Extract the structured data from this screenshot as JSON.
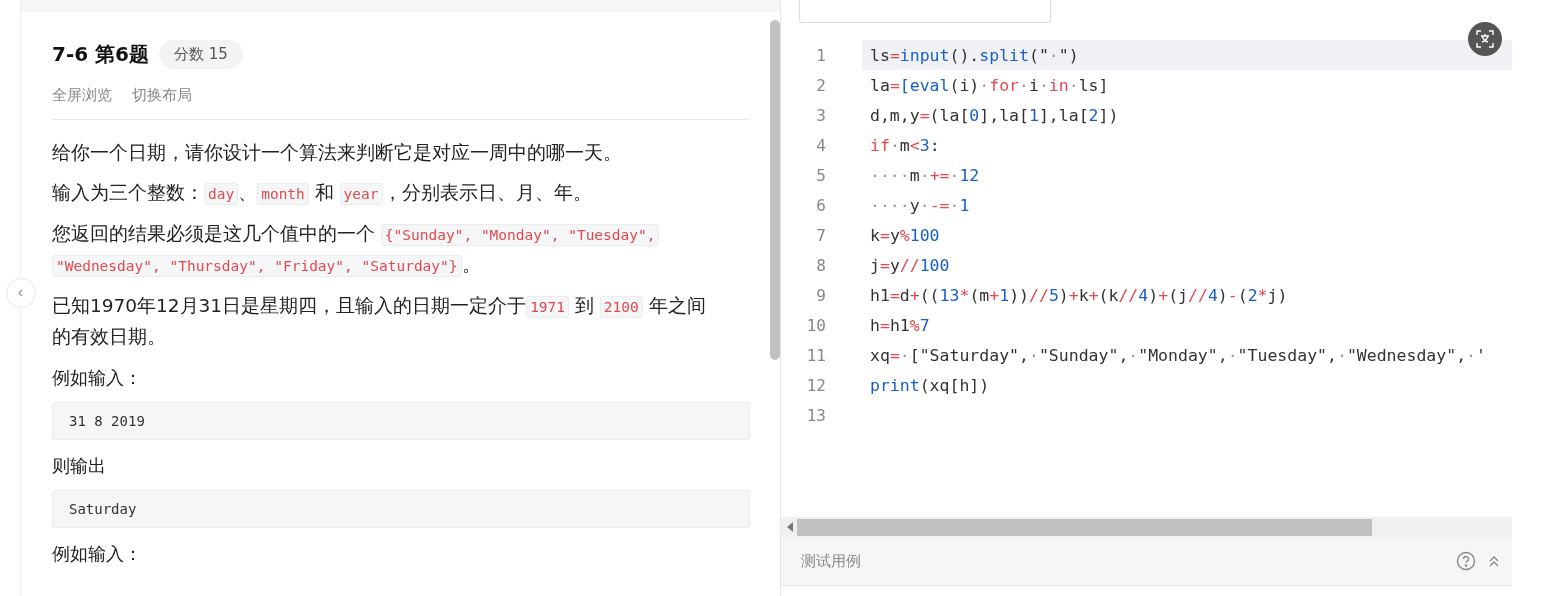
{
  "problem": {
    "title": "7-6 第6题",
    "score_badge": "分数 15",
    "actions": [
      "全屏浏览",
      "切换布局"
    ],
    "paragraphs": [
      [
        {
          "kind": "text",
          "t": "给你一个日期，请你设计一个算法来判断它是对应一周中的哪一天。"
        }
      ],
      [
        {
          "kind": "text",
          "t": "输入为三个整数："
        },
        {
          "kind": "code",
          "t": "day"
        },
        {
          "kind": "text",
          "t": "、"
        },
        {
          "kind": "code",
          "t": "month"
        },
        {
          "kind": "text",
          "t": " 和 "
        },
        {
          "kind": "code",
          "t": "year"
        },
        {
          "kind": "text",
          "t": "，分别表示日、月、年。"
        }
      ],
      [
        {
          "kind": "text",
          "t": "您返回的结果必须是这几个值中的一个 "
        },
        {
          "kind": "code",
          "t": "{\"Sunday\", \"Monday\", \"Tuesday\","
        },
        {
          "kind": "code",
          "t": "\"Wednesday\", \"Thursday\", \"Friday\", \"Saturday\"}"
        },
        {
          "kind": "text",
          "t": "。"
        }
      ],
      [
        {
          "kind": "text",
          "t": "已知1970年12月31日是星期四，且输入的日期一定介于"
        },
        {
          "kind": "code",
          "t": "1971"
        },
        {
          "kind": "text",
          "t": " 到 "
        },
        {
          "kind": "code",
          "t": "2100"
        },
        {
          "kind": "text",
          "t": " 年之间"
        },
        {
          "kind": "text",
          "t": "的有效日期。"
        }
      ]
    ],
    "examples": [
      {
        "label": "例如输入：",
        "sample": "31 8 2019"
      },
      {
        "label": "则输出",
        "sample": "Saturday"
      },
      {
        "label": "例如输入："
      }
    ]
  },
  "editor": {
    "lines": [
      {
        "number": "1",
        "current": true,
        "tokens": [
          {
            "kind": "id",
            "t": "ls"
          },
          {
            "kind": "op",
            "t": "="
          },
          {
            "kind": "fn",
            "t": "input"
          },
          {
            "kind": "id",
            "t": "()."
          },
          {
            "kind": "fn",
            "t": "split"
          },
          {
            "kind": "id",
            "t": "(\""
          },
          {
            "kind": "ws",
            "t": "·"
          },
          {
            "kind": "id",
            "t": "\")"
          }
        ]
      },
      {
        "number": "2",
        "current": false,
        "tokens": [
          {
            "kind": "id",
            "t": "la"
          },
          {
            "kind": "op",
            "t": "="
          },
          {
            "kind": "fn",
            "t": "[eval"
          },
          {
            "kind": "id",
            "t": "(i)"
          },
          {
            "kind": "ws",
            "t": "·"
          },
          {
            "kind": "kw",
            "t": "for"
          },
          {
            "kind": "ws",
            "t": "·"
          },
          {
            "kind": "id",
            "t": "i"
          },
          {
            "kind": "ws",
            "t": "·"
          },
          {
            "kind": "kw",
            "t": "in"
          },
          {
            "kind": "ws",
            "t": "·"
          },
          {
            "kind": "id",
            "t": "ls]"
          }
        ]
      },
      {
        "number": "3",
        "current": false,
        "tokens": [
          {
            "kind": "id",
            "t": "d,m,y"
          },
          {
            "kind": "op",
            "t": "="
          },
          {
            "kind": "id",
            "t": "(la["
          },
          {
            "kind": "num",
            "t": "0"
          },
          {
            "kind": "id",
            "t": "],la["
          },
          {
            "kind": "num",
            "t": "1"
          },
          {
            "kind": "id",
            "t": "],la["
          },
          {
            "kind": "num",
            "t": "2"
          },
          {
            "kind": "id",
            "t": "])"
          }
        ]
      },
      {
        "number": "4",
        "current": false,
        "tokens": [
          {
            "kind": "kw",
            "t": "if"
          },
          {
            "kind": "ws",
            "t": "·"
          },
          {
            "kind": "id",
            "t": "m"
          },
          {
            "kind": "op",
            "t": "<"
          },
          {
            "kind": "num",
            "t": "3"
          },
          {
            "kind": "id",
            "t": ":"
          }
        ]
      },
      {
        "number": "5",
        "current": false,
        "tokens": [
          {
            "kind": "ws",
            "t": "····"
          },
          {
            "kind": "id",
            "t": "m"
          },
          {
            "kind": "ws",
            "t": "·"
          },
          {
            "kind": "op",
            "t": "+="
          },
          {
            "kind": "ws",
            "t": "·"
          },
          {
            "kind": "num",
            "t": "12"
          }
        ]
      },
      {
        "number": "6",
        "current": false,
        "tokens": [
          {
            "kind": "ws",
            "t": "····"
          },
          {
            "kind": "id",
            "t": "y"
          },
          {
            "kind": "ws",
            "t": "·"
          },
          {
            "kind": "op",
            "t": "-="
          },
          {
            "kind": "ws",
            "t": "·"
          },
          {
            "kind": "num",
            "t": "1"
          }
        ]
      },
      {
        "number": "7",
        "current": false,
        "tokens": [
          {
            "kind": "id",
            "t": "k"
          },
          {
            "kind": "op",
            "t": "="
          },
          {
            "kind": "id",
            "t": "y"
          },
          {
            "kind": "op",
            "t": "%"
          },
          {
            "kind": "num",
            "t": "100"
          }
        ]
      },
      {
        "number": "8",
        "current": false,
        "tokens": [
          {
            "kind": "id",
            "t": "j"
          },
          {
            "kind": "op",
            "t": "="
          },
          {
            "kind": "id",
            "t": "y"
          },
          {
            "kind": "op",
            "t": "//"
          },
          {
            "kind": "num",
            "t": "100"
          }
        ]
      },
      {
        "number": "9",
        "current": false,
        "tokens": [
          {
            "kind": "id",
            "t": "h1"
          },
          {
            "kind": "op",
            "t": "="
          },
          {
            "kind": "id",
            "t": "d"
          },
          {
            "kind": "op",
            "t": "+"
          },
          {
            "kind": "id",
            "t": "(("
          },
          {
            "kind": "num",
            "t": "13"
          },
          {
            "kind": "op",
            "t": "*"
          },
          {
            "kind": "id",
            "t": "(m"
          },
          {
            "kind": "op",
            "t": "+"
          },
          {
            "kind": "num",
            "t": "1"
          },
          {
            "kind": "id",
            "t": "))"
          },
          {
            "kind": "op",
            "t": "//"
          },
          {
            "kind": "num",
            "t": "5"
          },
          {
            "kind": "id",
            "t": ")"
          },
          {
            "kind": "op",
            "t": "+"
          },
          {
            "kind": "id",
            "t": "k"
          },
          {
            "kind": "op",
            "t": "+"
          },
          {
            "kind": "id",
            "t": "(k"
          },
          {
            "kind": "op",
            "t": "//"
          },
          {
            "kind": "num",
            "t": "4"
          },
          {
            "kind": "id",
            "t": ")"
          },
          {
            "kind": "op",
            "t": "+"
          },
          {
            "kind": "id",
            "t": "(j"
          },
          {
            "kind": "op",
            "t": "//"
          },
          {
            "kind": "num",
            "t": "4"
          },
          {
            "kind": "id",
            "t": ")"
          },
          {
            "kind": "op",
            "t": "-"
          },
          {
            "kind": "id",
            "t": "("
          },
          {
            "kind": "num",
            "t": "2"
          },
          {
            "kind": "op",
            "t": "*"
          },
          {
            "kind": "id",
            "t": "j)"
          }
        ]
      },
      {
        "number": "10",
        "current": false,
        "tokens": [
          {
            "kind": "id",
            "t": "h"
          },
          {
            "kind": "op",
            "t": "="
          },
          {
            "kind": "id",
            "t": "h1"
          },
          {
            "kind": "op",
            "t": "%"
          },
          {
            "kind": "num",
            "t": "7"
          }
        ]
      },
      {
        "number": "11",
        "current": false,
        "tokens": [
          {
            "kind": "id",
            "t": "xq"
          },
          {
            "kind": "op",
            "t": "="
          },
          {
            "kind": "ws",
            "t": "·"
          },
          {
            "kind": "id",
            "t": "[\"Saturday\","
          },
          {
            "kind": "ws",
            "t": "·"
          },
          {
            "kind": "id",
            "t": "\"Sunday\","
          },
          {
            "kind": "ws",
            "t": "·"
          },
          {
            "kind": "id",
            "t": "\"Monday\","
          },
          {
            "kind": "ws",
            "t": "·"
          },
          {
            "kind": "id",
            "t": "\"Tuesday\","
          },
          {
            "kind": "ws",
            "t": "·"
          },
          {
            "kind": "id",
            "t": "\"Wednesday\","
          },
          {
            "kind": "ws",
            "t": "·"
          },
          {
            "kind": "id",
            "t": "'"
          }
        ]
      },
      {
        "number": "12",
        "current": false,
        "tokens": [
          {
            "kind": "fn",
            "t": "print"
          },
          {
            "kind": "id",
            "t": "(xq[h])"
          }
        ]
      },
      {
        "number": "13",
        "current": false
      }
    ]
  },
  "bottom_bar": {
    "title": "测试用例"
  }
}
